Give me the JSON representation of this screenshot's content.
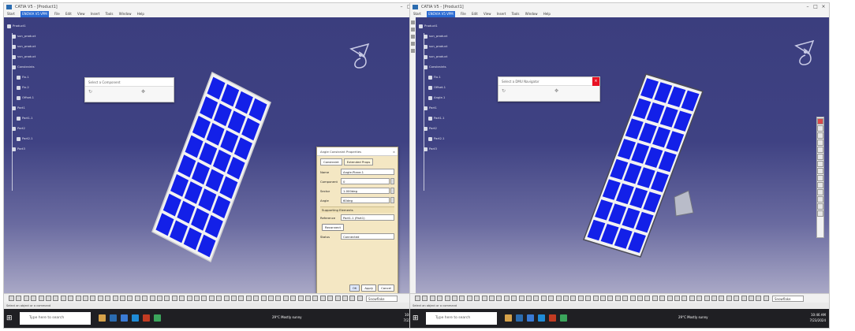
{
  "colors": {
    "viewport_top": "#3b3e7e",
    "viewport_bottom": "#a9a8c6",
    "panel_cell": "#1320e8",
    "panel_frame": "#f2f2f2",
    "dialog_bg": "#f4e7c3",
    "taskbar": "#1f1f23",
    "close_red": "#e81123"
  },
  "left": {
    "titlebar": {
      "title": "CATIA V5 - [Product1]"
    },
    "menubar": [
      "Start",
      "ENOVIA V5 VPM",
      "File",
      "Edit",
      "View",
      "Insert",
      "Tools",
      "Window",
      "Help"
    ],
    "tree": [
      "Product1",
      "sun_product",
      "sun_product",
      "sun_product",
      "Constraints",
      "Fix.1",
      "Fix.2",
      "Offset.1",
      "Part1",
      "Part1.1",
      "Part2",
      "Part2.1",
      "Part3"
    ],
    "floatbar": {
      "title": "Select a Component",
      "icons": [
        "rotate-icon",
        "move-icon"
      ]
    },
    "dialog": {
      "title": "Angle Constraint Properties",
      "close": "×",
      "tabs": [
        "Constraint",
        "Extended Props"
      ],
      "rows": [
        {
          "label": "Name",
          "value": "Angle.Plane.1"
        },
        {
          "label": "Component",
          "value": "0"
        },
        {
          "label": "Sector",
          "value": "1.000deg"
        },
        {
          "label": "Angle",
          "value": "60deg"
        }
      ],
      "group_label": "Supporting Elements",
      "ref_label": "Reference",
      "ref_value": "Part1.1 (Part1)",
      "reconnect": "Reconnect",
      "status_label": "Status",
      "status_value": "Connected",
      "buttons": [
        "OK",
        "Apply",
        "Cancel"
      ]
    },
    "cmdbar": {
      "search_text": "Snowflake"
    },
    "status": "Select an object or a command",
    "taskbar": {
      "search": "Type here to search",
      "weather": "29°C Mostly sunny",
      "time": "10:45 AM",
      "date": "7/23/2024"
    }
  },
  "right": {
    "titlebar": {
      "title": "CATIA V5 - [Product1]"
    },
    "menubar": [
      "Start",
      "ENOVIA V5 VPM",
      "File",
      "Edit",
      "View",
      "Insert",
      "Tools",
      "Window",
      "Help"
    ],
    "tree": [
      "Product1",
      "sun_product",
      "sun_product",
      "sun_product",
      "Constraints",
      "Fix.1",
      "Offset.1",
      "Angle.1",
      "Part1",
      "Part1.1",
      "Part2",
      "Part2.1",
      "Part3"
    ],
    "floatbar": {
      "title": "Select a DMU Navigator",
      "icons": [
        "rotate-icon",
        "move-icon"
      ]
    },
    "cmdbar": {
      "search_text": "Snowflake"
    },
    "status": "Select an object or a command",
    "taskbar": {
      "search": "Type here to search",
      "weather": "29°C Mostly sunny",
      "time": "10:46 AM",
      "date": "7/23/2024"
    }
  }
}
